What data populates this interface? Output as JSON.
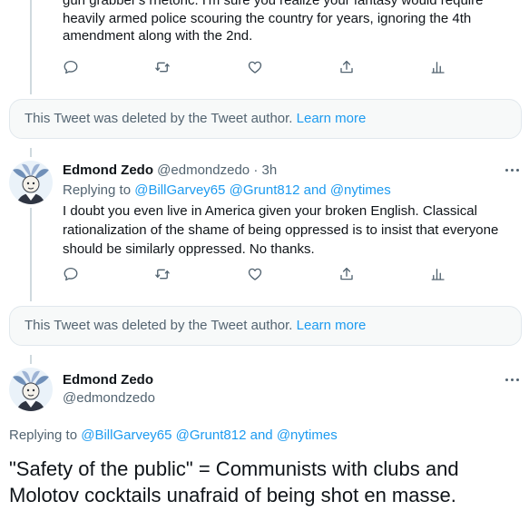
{
  "tweet_top": {
    "text_line1": "gun grabber's rhetoric.  I'm sure you realize your fantasy would require",
    "text_line2": "heavily armed police scouring the country for years, ignoring the 4th",
    "text_line3": "amendment along with the 2nd."
  },
  "deleted_notice_1": {
    "text": "This Tweet was deleted by the Tweet author.",
    "link": "Learn more"
  },
  "tweet_reply": {
    "display_name": "Edmond Zedo",
    "handle": "@edmondzedo",
    "separator": "·",
    "time": "3h",
    "replying_to_prefix": "Replying to",
    "mention1": "@BillGarvey65",
    "mention2": "@Grunt812",
    "and": "and",
    "mention3": "@nytimes",
    "text_line1": "I doubt you even live in America given your broken English.  Classical",
    "text_line2": "rationalization of the shame of being oppressed is to insist that everyone",
    "text_line3": "should be similarly oppressed.  No thanks."
  },
  "deleted_notice_2": {
    "text": "This Tweet was deleted by the Tweet author.",
    "link": "Learn more"
  },
  "tweet_main": {
    "display_name": "Edmond Zedo",
    "handle": "@edmondzedo",
    "replying_to_prefix": "Replying to",
    "mention1": "@BillGarvey65",
    "mention2": "@Grunt812",
    "and": "and",
    "mention3": "@nytimes",
    "text_line1": "\"Safety of the public\" = Communists with clubs and",
    "text_line2": "Molotov cocktails unafraid of being shot en masse."
  },
  "icons": [
    "reply-icon",
    "retweet-icon",
    "like-icon",
    "share-icon",
    "analytics-icon",
    "more-icon"
  ],
  "colors": {
    "link": "#1d9bf0",
    "muted": "#536471",
    "text": "#0f1419",
    "thread_line": "#cfd9de",
    "deleted_bg": "#f7f9f9"
  }
}
